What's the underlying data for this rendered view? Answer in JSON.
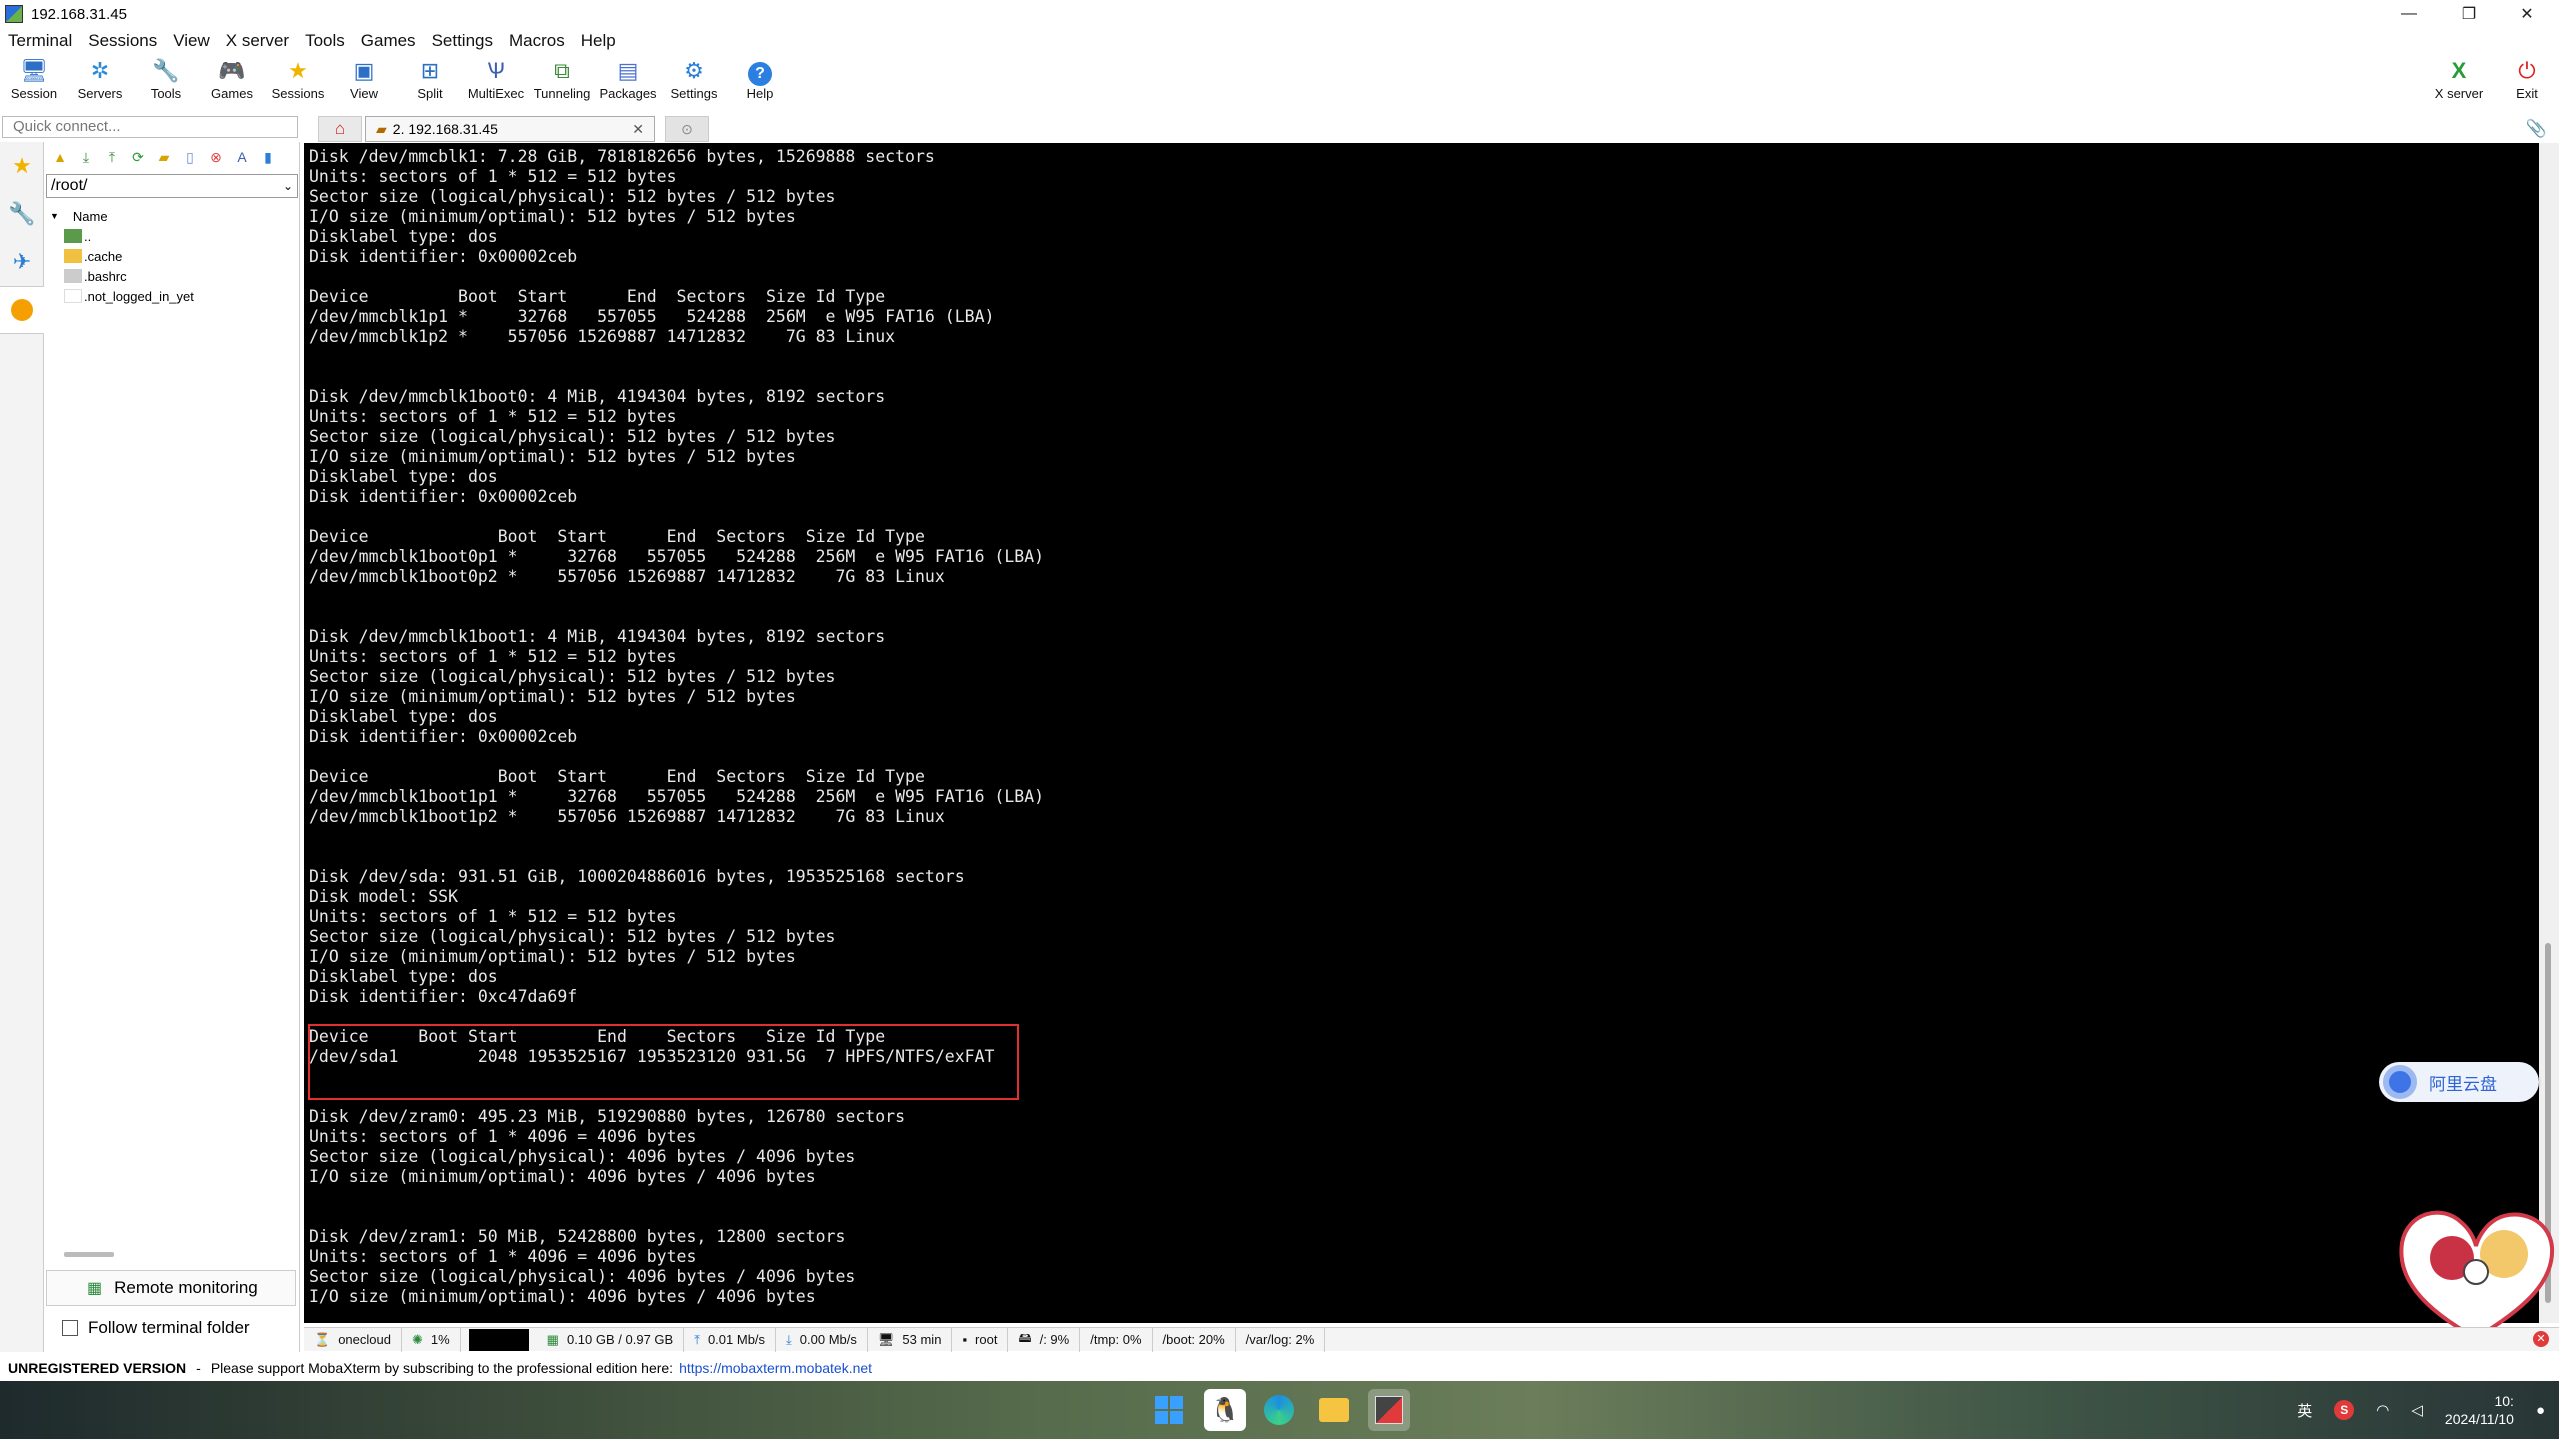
{
  "window": {
    "title": "192.168.31.45",
    "controls": {
      "minimize": "—",
      "restore": "❐",
      "close": "✕"
    }
  },
  "menu": [
    "Terminal",
    "Sessions",
    "View",
    "X server",
    "Tools",
    "Games",
    "Settings",
    "Macros",
    "Help"
  ],
  "toolbar": {
    "buttons": [
      {
        "label": "Session",
        "icon": "session-icon"
      },
      {
        "label": "Servers",
        "icon": "servers-icon"
      },
      {
        "label": "Tools",
        "icon": "tools-icon"
      },
      {
        "label": "Games",
        "icon": "games-icon"
      },
      {
        "label": "Sessions",
        "icon": "star-icon"
      },
      {
        "label": "View",
        "icon": "view-icon"
      },
      {
        "label": "Split",
        "icon": "split-icon"
      },
      {
        "label": "MultiExec",
        "icon": "multiexec-icon"
      },
      {
        "label": "Tunneling",
        "icon": "tunneling-icon"
      },
      {
        "label": "Packages",
        "icon": "packages-icon"
      },
      {
        "label": "Settings",
        "icon": "gear-icon"
      },
      {
        "label": "Help",
        "icon": "help-icon"
      }
    ],
    "xserver_label": "X server",
    "exit_label": "Exit"
  },
  "sidebar": {
    "quick_connect_placeholder": "Quick connect...",
    "path": "/root/",
    "tree_header": "Name",
    "files": [
      "..",
      ".cache",
      ".bashrc",
      ".not_logged_in_yet"
    ],
    "remote_monitoring": "Remote monitoring",
    "follow_terminal": "Follow terminal folder"
  },
  "tabs": {
    "session_tab": "2. 192.168.31.45",
    "close": "✕"
  },
  "terminal": {
    "lines": [
      "Disk /dev/mmcblk1: 7.28 GiB, 7818182656 bytes, 15269888 sectors",
      "Units: sectors of 1 * 512 = 512 bytes",
      "Sector size (logical/physical): 512 bytes / 512 bytes",
      "I/O size (minimum/optimal): 512 bytes / 512 bytes",
      "Disklabel type: dos",
      "Disk identifier: 0x00002ceb",
      "",
      "Device         Boot  Start      End  Sectors  Size Id Type",
      "/dev/mmcblk1p1 *     32768   557055   524288  256M  e W95 FAT16 (LBA)",
      "/dev/mmcblk1p2 *    557056 15269887 14712832    7G 83 Linux",
      "",
      "",
      "Disk /dev/mmcblk1boot0: 4 MiB, 4194304 bytes, 8192 sectors",
      "Units: sectors of 1 * 512 = 512 bytes",
      "Sector size (logical/physical): 512 bytes / 512 bytes",
      "I/O size (minimum/optimal): 512 bytes / 512 bytes",
      "Disklabel type: dos",
      "Disk identifier: 0x00002ceb",
      "",
      "Device             Boot  Start      End  Sectors  Size Id Type",
      "/dev/mmcblk1boot0p1 *     32768   557055   524288  256M  e W95 FAT16 (LBA)",
      "/dev/mmcblk1boot0p2 *    557056 15269887 14712832    7G 83 Linux",
      "",
      "",
      "Disk /dev/mmcblk1boot1: 4 MiB, 4194304 bytes, 8192 sectors",
      "Units: sectors of 1 * 512 = 512 bytes",
      "Sector size (logical/physical): 512 bytes / 512 bytes",
      "I/O size (minimum/optimal): 512 bytes / 512 bytes",
      "Disklabel type: dos",
      "Disk identifier: 0x00002ceb",
      "",
      "Device             Boot  Start      End  Sectors  Size Id Type",
      "/dev/mmcblk1boot1p1 *     32768   557055   524288  256M  e W95 FAT16 (LBA)",
      "/dev/mmcblk1boot1p2 *    557056 15269887 14712832    7G 83 Linux",
      "",
      "",
      "Disk /dev/sda: 931.51 GiB, 1000204886016 bytes, 1953525168 sectors",
      "Disk model: SSK",
      "Units: sectors of 1 * 512 = 512 bytes",
      "Sector size (logical/physical): 512 bytes / 512 bytes",
      "I/O size (minimum/optimal): 512 bytes / 512 bytes",
      "Disklabel type: dos",
      "Disk identifier: 0xc47da69f",
      "",
      "Device     Boot Start        End    Sectors   Size Id Type",
      "/dev/sda1        2048 1953525167 1953523120 931.5G  7 HPFS/NTFS/exFAT",
      "",
      "",
      "Disk /dev/zram0: 495.23 MiB, 519290880 bytes, 126780 sectors",
      "Units: sectors of 1 * 4096 = 4096 bytes",
      "Sector size (logical/physical): 4096 bytes / 4096 bytes",
      "I/O size (minimum/optimal): 4096 bytes / 4096 bytes",
      "",
      "",
      "Disk /dev/zram1: 50 MiB, 52428800 bytes, 12800 sectors",
      "Units: sectors of 1 * 4096 = 4096 bytes",
      "Sector size (logical/physical): 4096 bytes / 4096 bytes",
      "I/O size (minimum/optimal): 4096 bytes / 4096 bytes"
    ]
  },
  "aliyun_label": "阿里云盘",
  "statusbar": {
    "host": "onecloud",
    "cpu": "1%",
    "memory": "0.10 GB / 0.97 GB",
    "upload": "0.01 Mb/s",
    "download": "0.00 Mb/s",
    "uptime": "53 min",
    "user": "root",
    "disk_root": "/: 9%",
    "disk_tmp": "/tmp: 0%",
    "disk_boot": "/boot: 20%",
    "disk_varlog": "/var/log: 2%"
  },
  "nag": {
    "unregistered": "UNREGISTERED VERSION",
    "separator": "-",
    "message": "Please support MobaXterm by subscribing to the professional edition here:",
    "link": "https://mobaxterm.mobatek.net"
  },
  "taskbar": {
    "tray_lang": "英",
    "clock_time": "10:",
    "clock_date": "2024/11/10"
  },
  "colors": {
    "terminal_bg": "#000000",
    "terminal_fg": "#e8e8e8",
    "highlight": "#e03030",
    "link": "#1a4fd0"
  }
}
